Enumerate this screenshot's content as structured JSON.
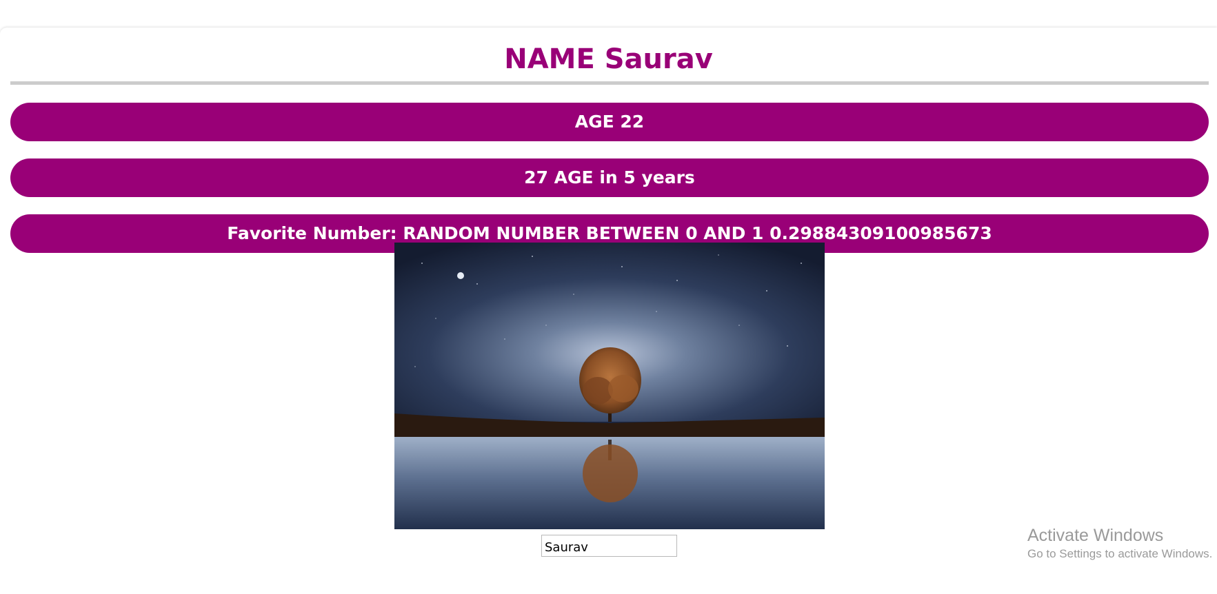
{
  "header": {
    "title": "NAME Saurav"
  },
  "rows": {
    "age": "AGE 22",
    "future_age": "27 AGE in 5 years",
    "favorite": "Favorite Number: RANDOM NUMBER BETWEEN 0 AND 1 0.29884309100985673"
  },
  "form": {
    "name_value": "Saurav"
  },
  "watermark": {
    "title": "Activate Windows",
    "subtitle": "Go to Settings to activate Windows."
  },
  "colors": {
    "accent": "#990077",
    "rule": "#cccccc",
    "watermark": "#9a9a9a"
  }
}
